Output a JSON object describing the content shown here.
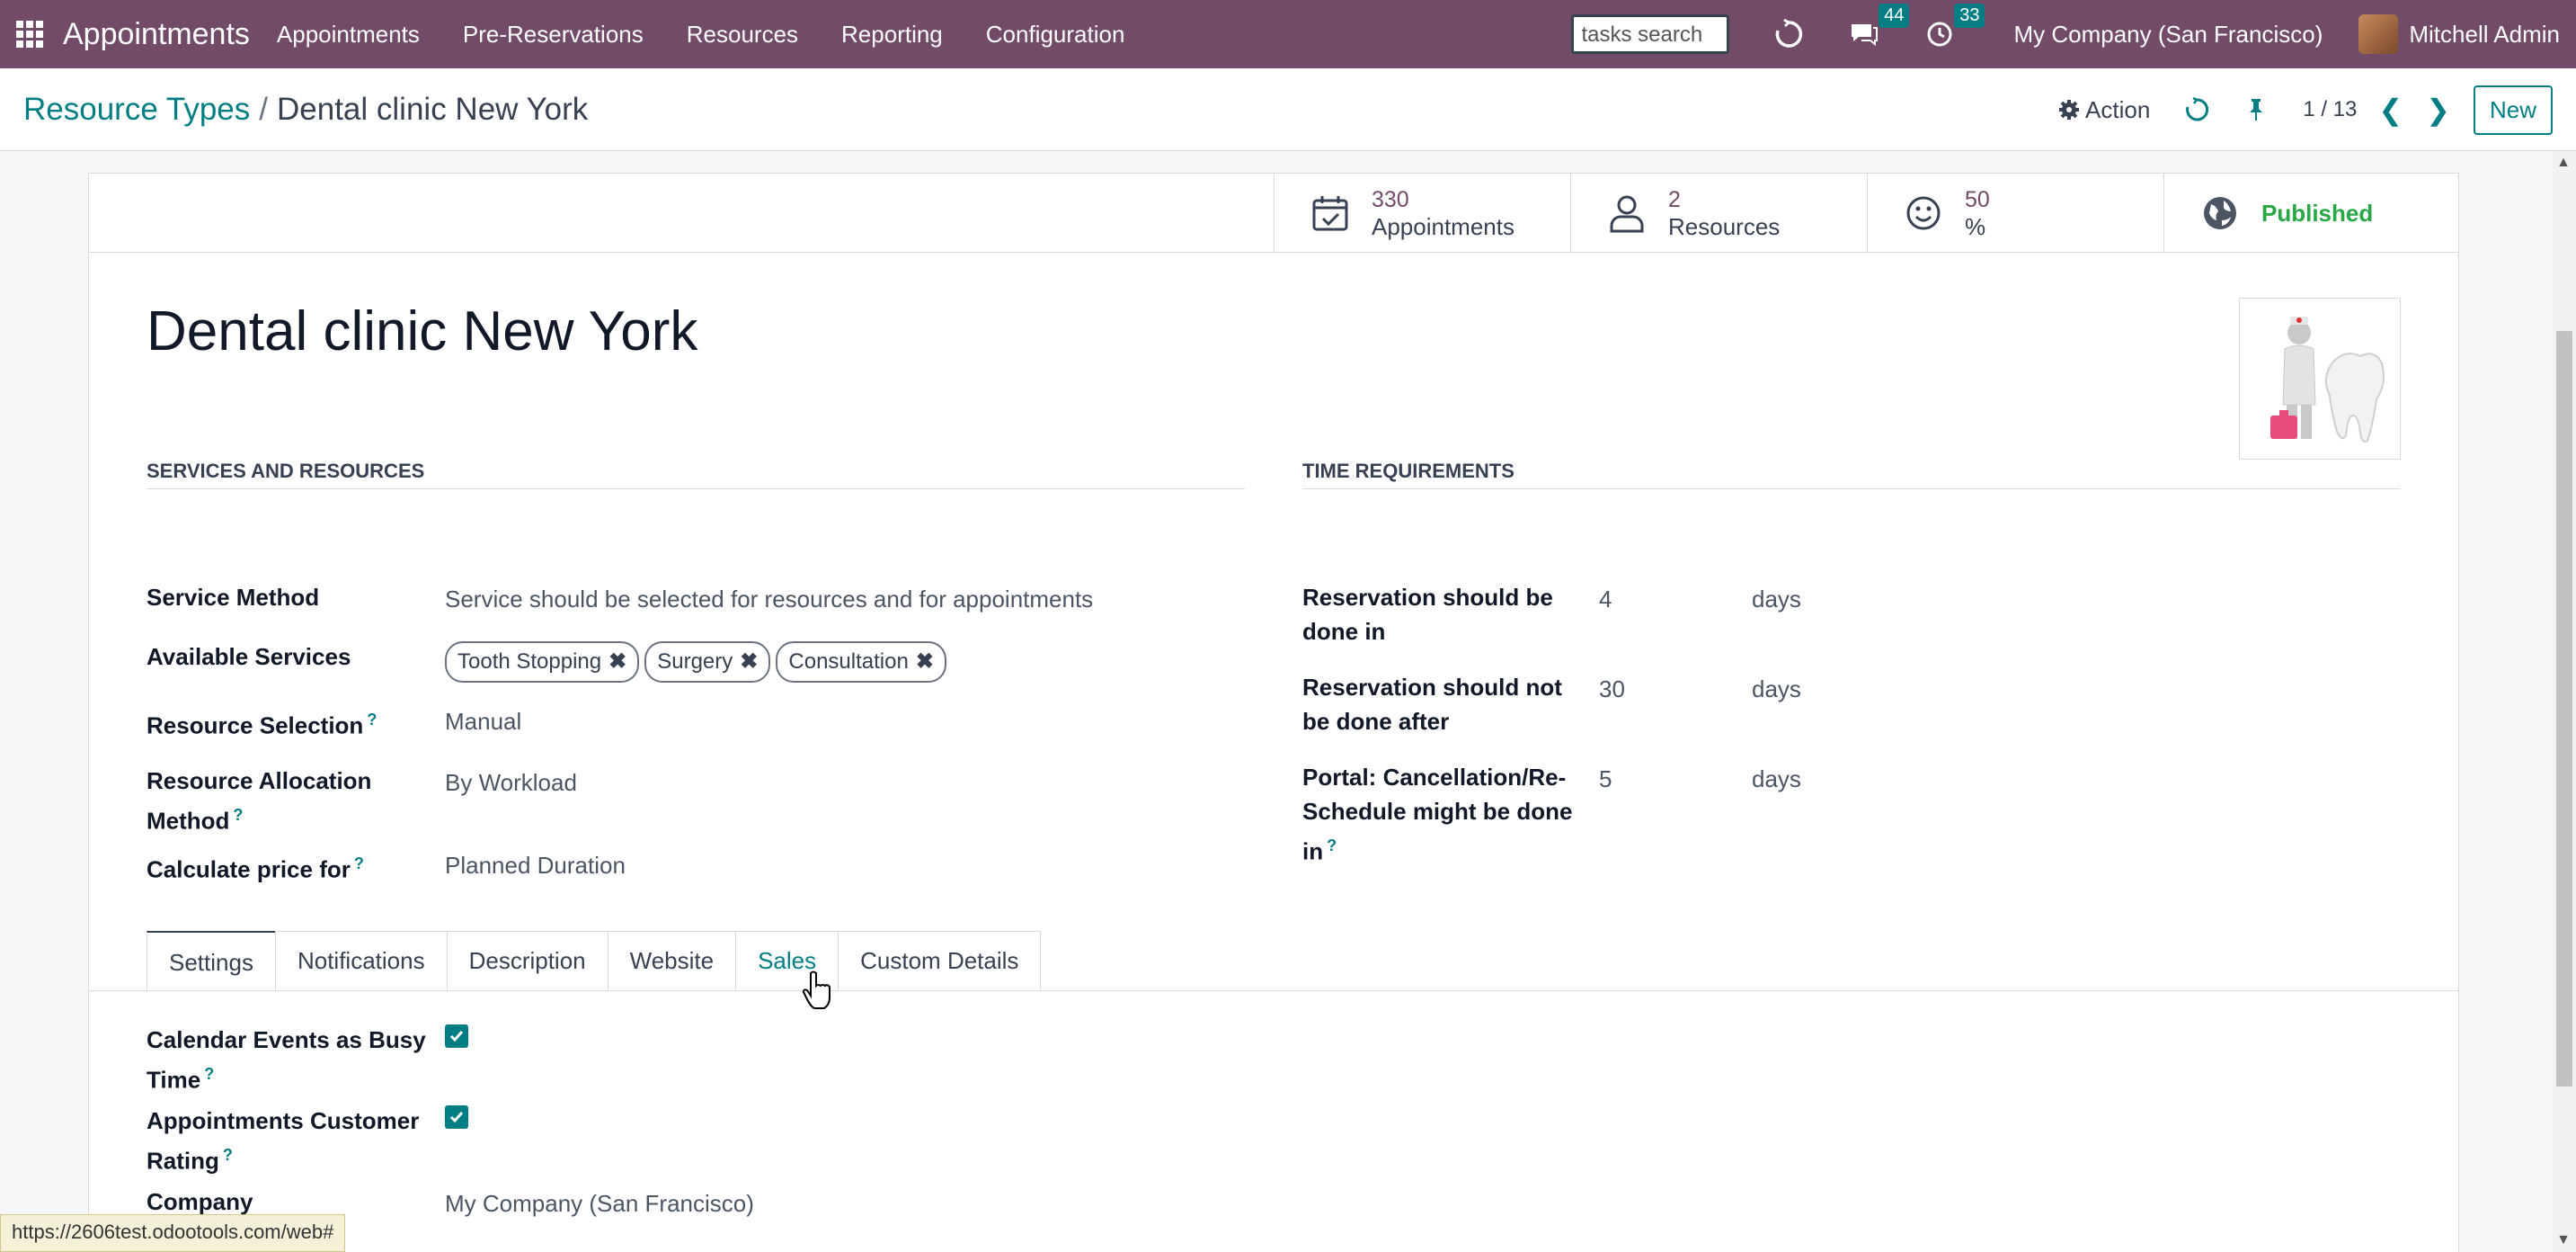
{
  "navbar": {
    "brand": "Appointments",
    "menu": [
      "Appointments",
      "Pre-Reservations",
      "Resources",
      "Reporting",
      "Configuration"
    ],
    "search_value": "tasks search",
    "messages_count": "44",
    "activities_count": "33",
    "company": "My Company (San Francisco)",
    "user": "Mitchell Admin"
  },
  "control": {
    "breadcrumb_parent": "Resource Types",
    "breadcrumb_sep": "/",
    "breadcrumb_current": "Dental clinic New York",
    "action_label": "Action",
    "pager": "1 / 13",
    "new_label": "New"
  },
  "stats": {
    "appointments_value": "330",
    "appointments_label": "Appointments",
    "resources_value": "2",
    "resources_label": "Resources",
    "rating_value": "50",
    "rating_label": "%",
    "published_label": "Published"
  },
  "record": {
    "title": "Dental clinic New York"
  },
  "services": {
    "section_title": "SERVICES AND RESOURCES",
    "service_method_label": "Service Method",
    "service_method_value": "Service should be selected for resources and for appointments",
    "available_services_label": "Available Services",
    "tags": [
      "Tooth Stopping",
      "Surgery",
      "Consultation"
    ],
    "resource_selection_label": "Resource Selection",
    "resource_selection_value": "Manual",
    "allocation_label_1": "Resource Allocation",
    "allocation_label_2": "Method",
    "allocation_value": "By Workload",
    "price_label": "Calculate price for",
    "price_value": "Planned Duration"
  },
  "time": {
    "section_title": "TIME REQUIREMENTS",
    "r1_label_1": "Reservation should be",
    "r1_label_2": "done in",
    "r1_value": "4",
    "r1_unit": "days",
    "r2_label_1": "Reservation should not",
    "r2_label_2": "be done after",
    "r2_value": "30",
    "r2_unit": "days",
    "r3_label_1": "Portal: Cancellation/Re-",
    "r3_label_2": "Schedule might be done",
    "r3_label_3": "in",
    "r3_value": "5",
    "r3_unit": "days"
  },
  "tabs": [
    "Settings",
    "Notifications",
    "Description",
    "Website",
    "Sales",
    "Custom Details"
  ],
  "settings": {
    "busy_label_1": "Calendar Events as Busy",
    "busy_label_2": "Time",
    "busy_checked": true,
    "rating_label_1": "Appointments Customer",
    "rating_label_2": "Rating",
    "rating_checked": true,
    "company_label": "Company",
    "company_value": "My Company (San Francisco)"
  },
  "status_url": "https://2606test.odootools.com/web#",
  "question_mark": "?",
  "colors": {
    "navbar": "#714b67",
    "accent": "#017e84",
    "published": "#28a745"
  }
}
